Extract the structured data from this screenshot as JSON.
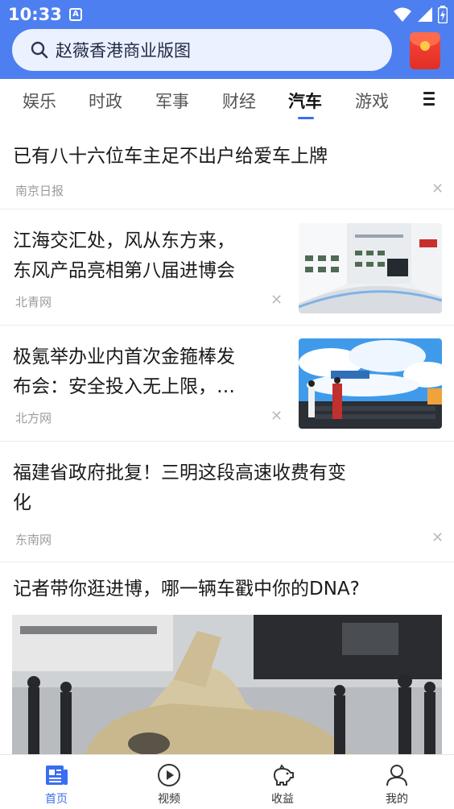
{
  "status": {
    "time": "10:33",
    "notif_letter": "A"
  },
  "search": {
    "query": "赵薇香港商业版图"
  },
  "tabs": [
    "娱乐",
    "时政",
    "军事",
    "财经",
    "汽车",
    "游戏"
  ],
  "active_tab": "汽车",
  "feed": [
    {
      "title_lines": [
        "已有八十六位车主足不出户给爱车上牌"
      ],
      "source": "南京日报"
    },
    {
      "title_lines": [
        "江海交汇处，风从东方来，",
        "东风产品亮相第八届进博会"
      ],
      "source": "北青网",
      "thumb": "exhibition-booth-image"
    },
    {
      "title_lines": [
        "极氪举办业内首次金箍棒发",
        "布会：安全投入无上限，…"
      ],
      "source": "北方网",
      "thumb": "launch-stage-image"
    },
    {
      "title_lines": [
        "福建省政府批复！三明这段高速收费有变",
        "化"
      ],
      "source": "东南网"
    },
    {
      "title_lines": [
        "记者带你逛进博，哪一辆车戳中你的DNA?"
      ],
      "image": "concept-car-photo"
    }
  ],
  "nav": [
    {
      "label": "首页",
      "icon": "news-icon",
      "active": true
    },
    {
      "label": "视频",
      "icon": "play-icon",
      "active": false
    },
    {
      "label": "收益",
      "icon": "piggy-bank-icon",
      "active": false
    },
    {
      "label": "我的",
      "icon": "user-icon",
      "active": false
    }
  ],
  "colors": {
    "header": "#4d7ff0",
    "accent": "#3a6ef0"
  }
}
